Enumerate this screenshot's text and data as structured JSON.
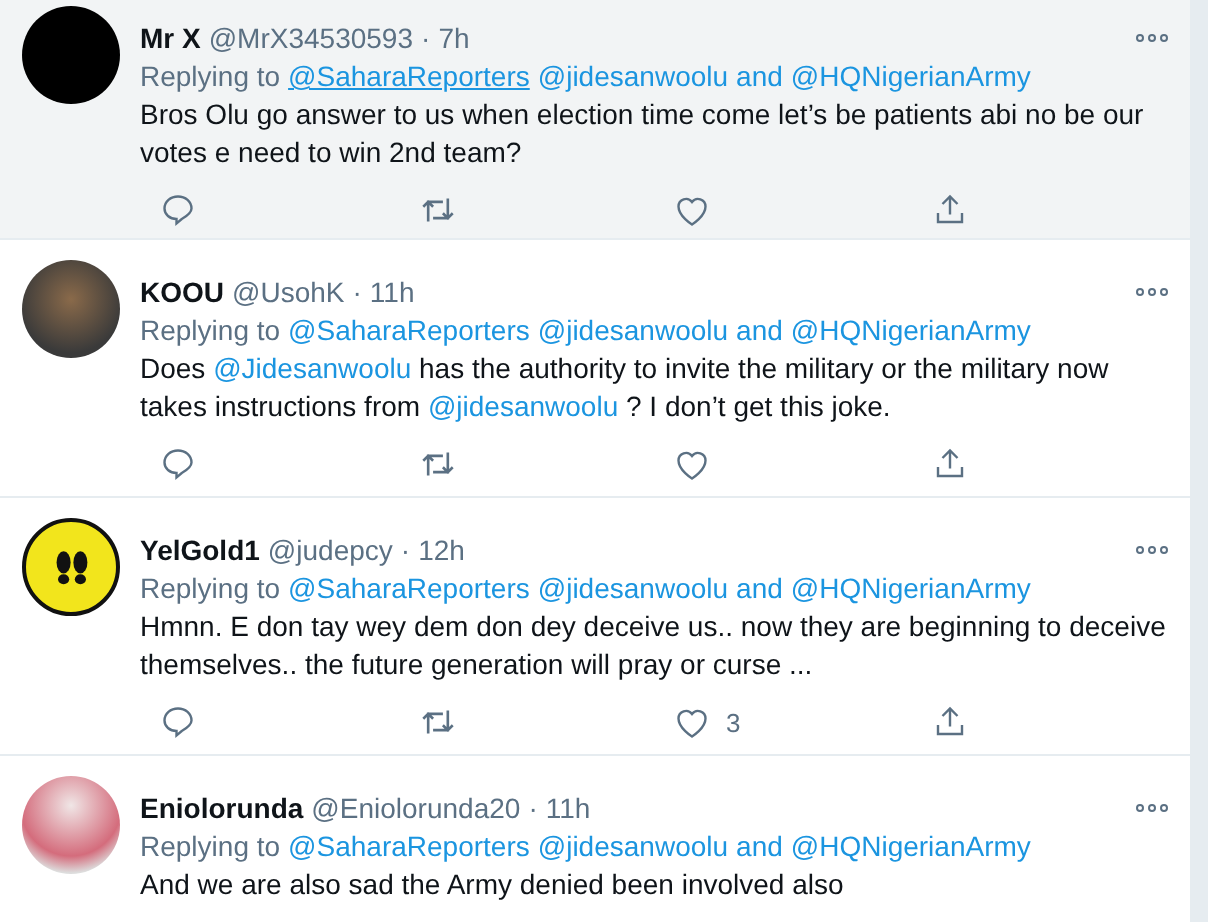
{
  "tweets": [
    {
      "name": "Mr X",
      "handle": "@MrX34530593",
      "separator": "·",
      "time": "7h",
      "hovered": true,
      "avatar": {
        "kind": "black"
      },
      "reply_prefix": "Replying to",
      "reply_targets": [
        {
          "text": "@SaharaReporters",
          "underlined": true
        },
        {
          "text": "@jidesanwoolu",
          "underlined": false
        },
        {
          "text": "and",
          "underlined": false
        },
        {
          "text": "@HQNigerianArmy",
          "underlined": false
        }
      ],
      "body": [
        {
          "kind": "text",
          "text": "Bros Olu go answer to us when election time come let’s be patients abi no be our votes e need to win 2nd team?"
        }
      ]
    },
    {
      "name": "KOOU",
      "handle": "@UsohK",
      "separator": "·",
      "time": "11h",
      "hovered": false,
      "avatar": {
        "kind": "photo"
      },
      "reply_prefix": "Replying to",
      "reply_targets": [
        {
          "text": "@SaharaReporters",
          "underlined": false
        },
        {
          "text": "@jidesanwoolu",
          "underlined": false
        },
        {
          "text": "and",
          "underlined": false
        },
        {
          "text": "@HQNigerianArmy",
          "underlined": false
        }
      ],
      "body": [
        {
          "kind": "text",
          "text": "Does"
        },
        {
          "kind": "mention",
          "text": "@Jidesanwoolu"
        },
        {
          "kind": "text",
          "text": "has the authority to invite the military or the military now takes instructions from"
        },
        {
          "kind": "mention",
          "text": "@jidesanwoolu"
        },
        {
          "kind": "text",
          "text": "? I don’t get this joke."
        }
      ]
    },
    {
      "name": "YelGold1",
      "handle": "@judepcy",
      "separator": "·",
      "time": "12h",
      "hovered": false,
      "avatar": {
        "kind": "sign"
      },
      "reply_prefix": "Replying to",
      "reply_targets": [
        {
          "text": "@SaharaReporters",
          "underlined": false
        },
        {
          "text": "@jidesanwoolu",
          "underlined": false
        },
        {
          "text": "and",
          "underlined": false
        },
        {
          "text": "@HQNigerianArmy",
          "underlined": false
        }
      ],
      "body": [
        {
          "kind": "text",
          "text": "Hmnn.   E don tay wey dem don dey deceive us.. now they are beginning to deceive themselves..  the future generation will pray or curse ..."
        }
      ],
      "like_count": "3"
    },
    {
      "name": "Eniolorunda",
      "handle": "@Eniolorunda20",
      "separator": "·",
      "time": "11h",
      "hovered": false,
      "avatar": {
        "kind": "light"
      },
      "reply_prefix": "Replying to",
      "reply_targets": [
        {
          "text": "@SaharaReporters",
          "underlined": false
        },
        {
          "text": "@jidesanwoolu",
          "underlined": false
        },
        {
          "text": "and",
          "underlined": false
        },
        {
          "text": "@HQNigerianArmy",
          "underlined": false
        }
      ],
      "body": [
        {
          "kind": "text",
          "text": "And we are also sad the Army denied been involved also"
        }
      ]
    }
  ]
}
